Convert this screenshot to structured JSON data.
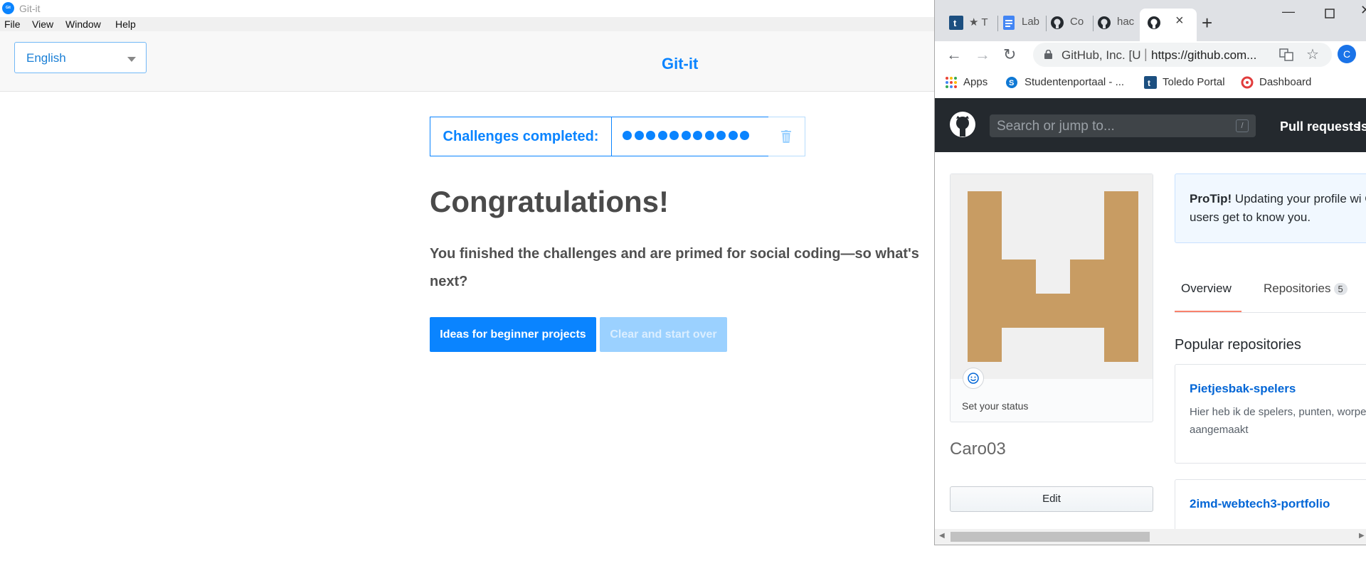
{
  "gitit": {
    "window_title": "Git-it",
    "menu": [
      "File",
      "View",
      "Window",
      "Help"
    ],
    "language": "English",
    "header_title": "Git-it",
    "progress_label": "Challenges completed:",
    "challenges_completed": 11,
    "heading": "Congratulations!",
    "message": "You finished the challenges and are primed for social coding—so what's next?",
    "btn_ideas": "Ideas for beginner projects",
    "btn_clear": "Clear and start over",
    "accent_color": "#0a84ff"
  },
  "chrome": {
    "tabs": [
      {
        "label": "★ T",
        "icon": "toledo-icon"
      },
      {
        "label": "Lab",
        "icon": "docs-icon"
      },
      {
        "label": "Co",
        "icon": "github-icon"
      },
      {
        "label": "hac",
        "icon": "github-icon"
      }
    ],
    "active_tab_close": "×",
    "new_tab": "+",
    "org": "GitHub, Inc. [U",
    "url": "https://github.com...",
    "profile_initial": "C",
    "bookmarks": [
      "Apps",
      "Studentenportaal - ...",
      "Toledo Portal",
      "Dashboard"
    ]
  },
  "github": {
    "search_placeholder": "Search or jump to...",
    "search_key": "/",
    "nav": [
      "Pull requests",
      "Is"
    ],
    "status": "Set your status",
    "username": "Caro03",
    "edit": "Edit",
    "protip_bold": "ProTip!",
    "protip_text": "Updating your profile wi GitHub users get to know you.",
    "tabs": [
      {
        "label": "Overview"
      },
      {
        "label": "Repositories",
        "count": "5"
      }
    ],
    "popular": "Popular repositories",
    "repos": [
      {
        "name": "Pietjesbak-spelers",
        "desc": "Hier heb ik de spelers, punten, worpen aangemaakt"
      },
      {
        "name": "2imd-webtech3-portfolio",
        "desc": ""
      }
    ],
    "identicon_color": "#c89c63"
  }
}
